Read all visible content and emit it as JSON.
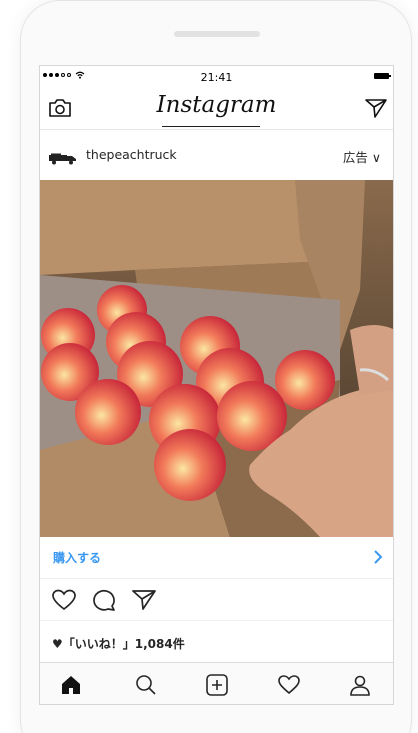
{
  "status_bar": {
    "time": "21:41"
  },
  "header": {
    "logo": "Instagram",
    "icons": [
      "camera-icon",
      "direct-message-icon"
    ]
  },
  "post": {
    "username": "thepeachtruck",
    "ad_label": "広告 ∨",
    "image_description_icon": "peaches-in-box-photo",
    "cta_label": "購入する",
    "likes_text": "♥「いいね！」1,084件"
  },
  "actions": [
    "heart-icon",
    "comment-icon",
    "share-icon"
  ],
  "tabbar": [
    "home-icon",
    "search-icon",
    "add-post-icon",
    "activity-heart-icon",
    "profile-icon"
  ],
  "colors": {
    "accent": "#3897f0",
    "text": "#262626",
    "border": "#dcdcdc"
  }
}
